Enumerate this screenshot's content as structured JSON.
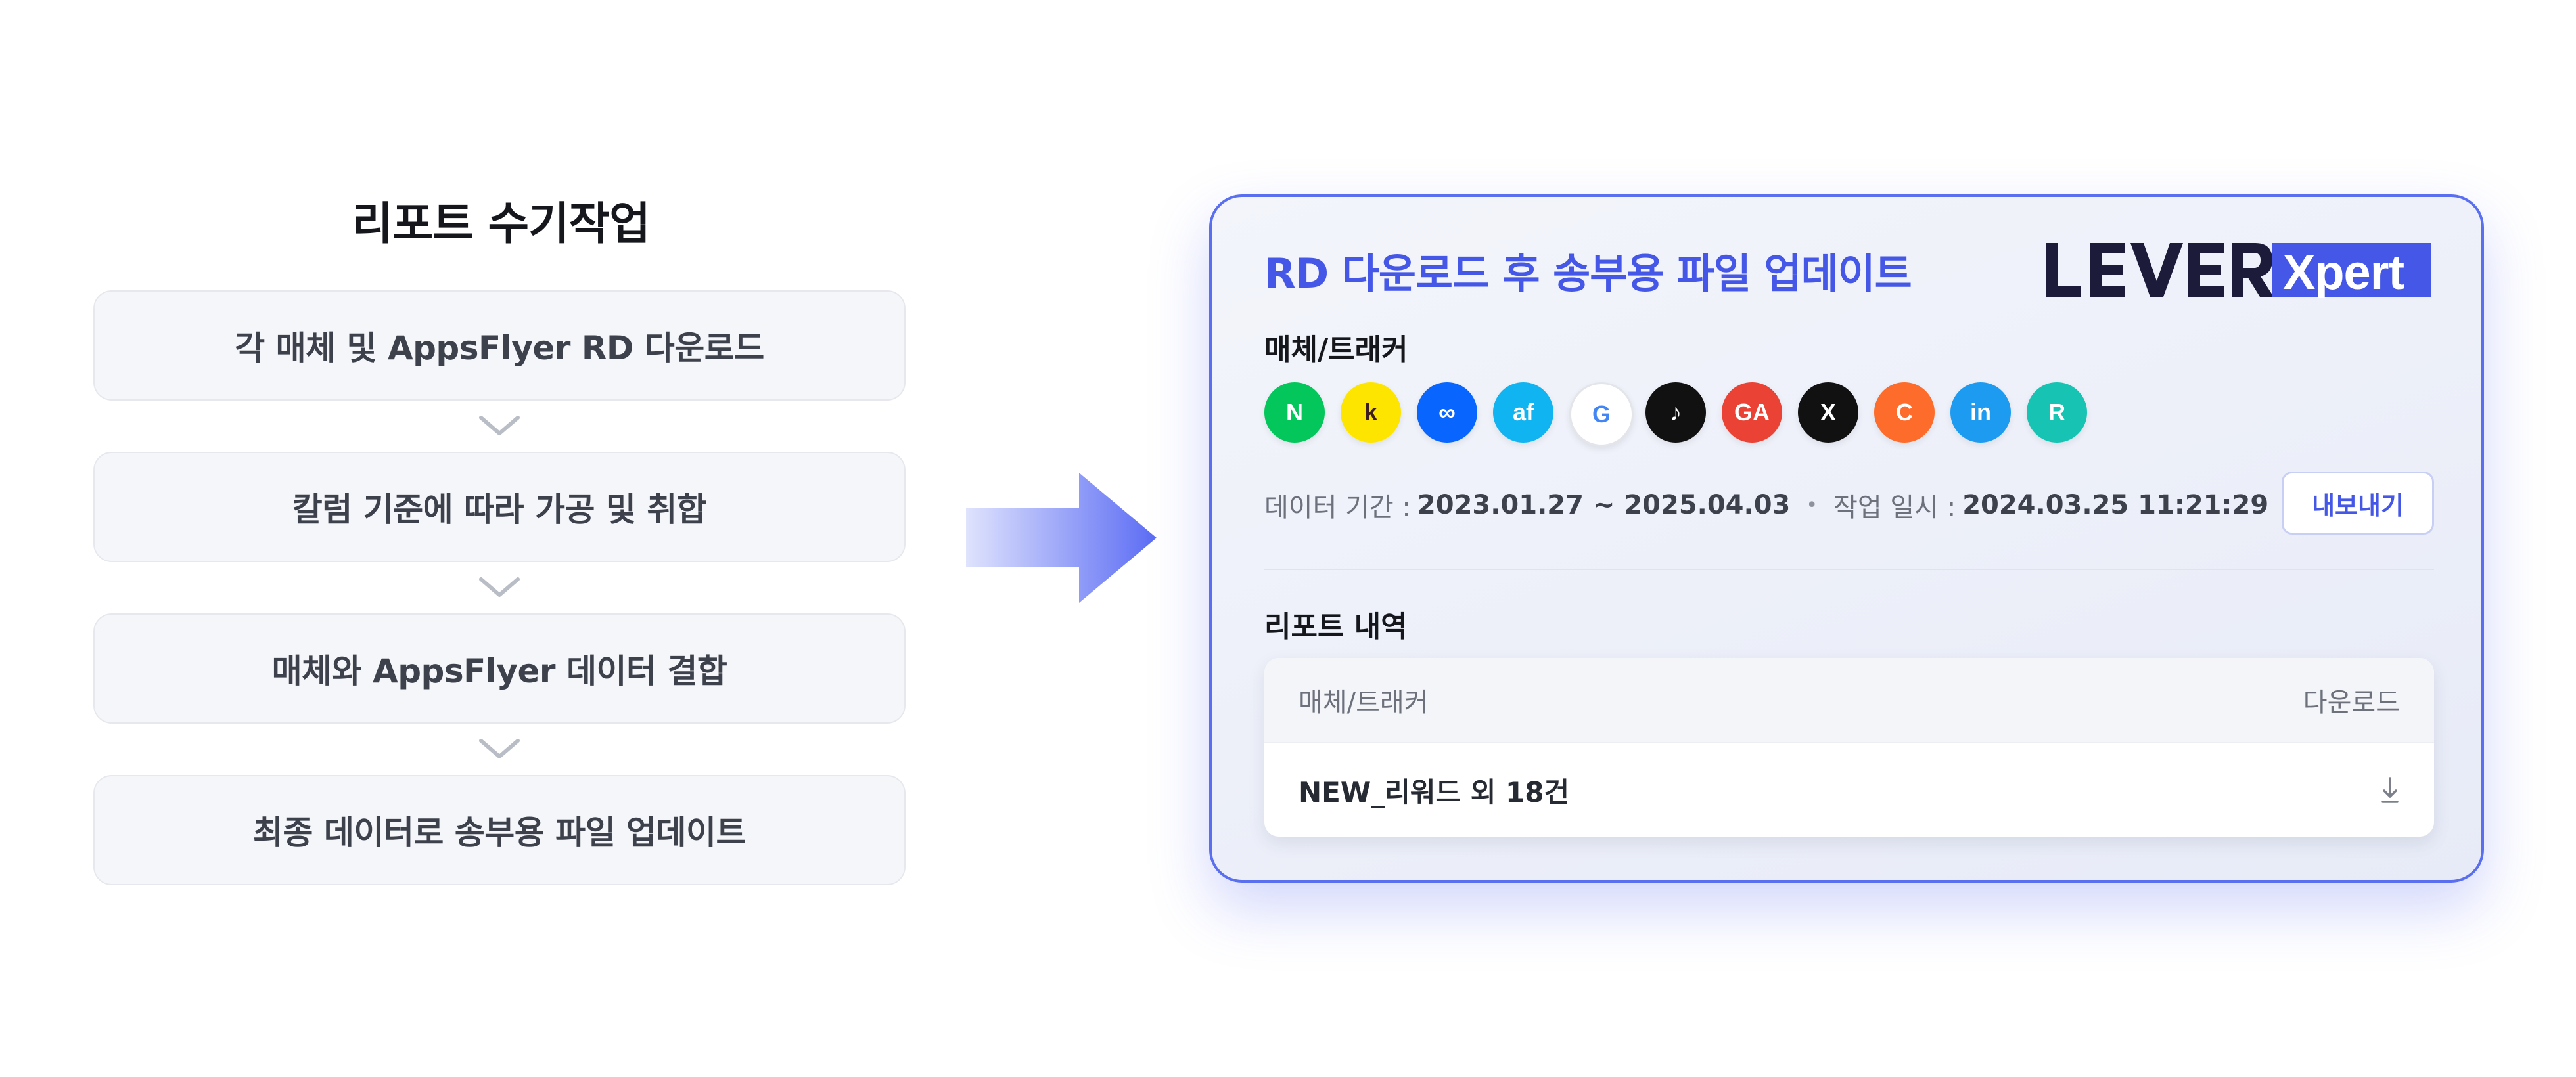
{
  "left": {
    "title": "리포트 수기작업",
    "steps": [
      "각 매체 및 AppsFlyer RD 다운로드",
      "칼럼 기준에 따라 가공 및 취합",
      "매체와 AppsFlyer 데이터 결합",
      "최종 데이터로 송부용 파일 업데이트"
    ]
  },
  "panel": {
    "title": "RD 다운로드 후 송부용 파일 업데이트",
    "logo": {
      "word": "LEVER",
      "badge": "Xpert",
      "ink": "#1c1c3a",
      "accent": "#4557e6"
    },
    "media_label": "매체/트래커",
    "media_icons": [
      {
        "name": "naver-icon",
        "text": "N",
        "bg": "#03c75a",
        "fg": "#ffffff"
      },
      {
        "name": "kakao-icon",
        "text": "k",
        "bg": "#fee500",
        "fg": "#3c1e1e"
      },
      {
        "name": "meta-icon",
        "text": "∞",
        "bg": "#0866ff",
        "fg": "#ffffff"
      },
      {
        "name": "appsflyer-icon",
        "text": "af",
        "bg": "#0fb4f0",
        "fg": "#ffffff"
      },
      {
        "name": "google-icon",
        "text": "G",
        "bg": "#ffffff",
        "fg": "#4285f4"
      },
      {
        "name": "tiktok-icon",
        "text": "♪",
        "bg": "#111111",
        "fg": "#ffffff"
      },
      {
        "name": "google-analytics-icon",
        "text": "GA",
        "bg": "#ea4335",
        "fg": "#ffffff"
      },
      {
        "name": "x-icon",
        "text": "X",
        "bg": "#111111",
        "fg": "#ffffff"
      },
      {
        "name": "criteo-icon",
        "text": "C",
        "bg": "#fe6c2b",
        "fg": "#ffffff"
      },
      {
        "name": "linkedin-icon",
        "text": "in",
        "bg": "#1d9bf0",
        "fg": "#ffffff"
      },
      {
        "name": "r-icon",
        "text": "R",
        "bg": "#17c3b2",
        "fg": "#ffffff"
      }
    ],
    "period_label": "데이터 기간 :",
    "period_value": "2023.01.27 ~ 2025.04.03",
    "separator": "•",
    "work_label": "작업 일시 :",
    "work_value": "2024.03.25 11:21:29",
    "export_label": "내보내기",
    "report_label": "리포트 내역",
    "table": {
      "col_media": "매체/트래커",
      "col_download": "다운로드",
      "rows": [
        {
          "name": "NEW_리워드 외 18건"
        }
      ]
    }
  },
  "colors": {
    "accent": "#4557e6",
    "panel_border": "#5a6ef0",
    "arrow": "#5b6cf4"
  }
}
